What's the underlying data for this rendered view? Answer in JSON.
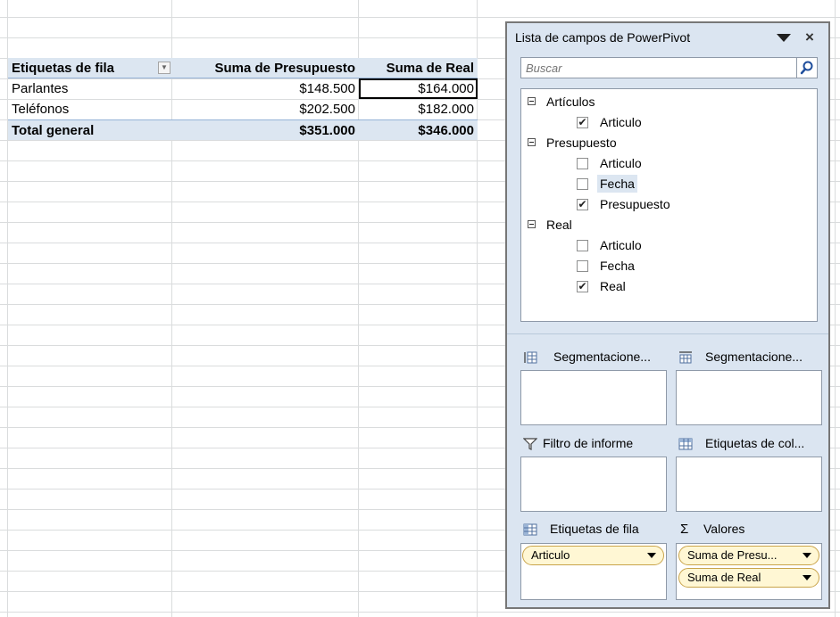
{
  "pivot": {
    "header": {
      "row_labels": "Etiquetas de fila",
      "col_budget": "Suma de Presupuesto",
      "col_actual": "Suma de Real"
    },
    "rows": [
      {
        "label": "Parlantes",
        "budget": "$148.500",
        "actual": "$164.000"
      },
      {
        "label": "Teléfonos",
        "budget": "$202.500",
        "actual": "$182.000"
      }
    ],
    "total": {
      "label": "Total general",
      "budget": "$351.000",
      "actual": "$346.000"
    },
    "dropdown_glyph": "▼"
  },
  "pane": {
    "title": "Lista de campos de PowerPivot",
    "close_glyph": "×",
    "search_placeholder": "Buscar",
    "tables": [
      {
        "name": "Artículos",
        "fields": [
          {
            "name": "Articulo",
            "checked": true
          }
        ]
      },
      {
        "name": "Presupuesto",
        "fields": [
          {
            "name": "Articulo",
            "checked": false
          },
          {
            "name": "Fecha",
            "checked": false
          },
          {
            "name": "Presupuesto",
            "checked": true
          }
        ]
      },
      {
        "name": "Real",
        "fields": [
          {
            "name": "Articulo",
            "checked": false
          },
          {
            "name": "Fecha",
            "checked": false
          },
          {
            "name": "Real",
            "checked": true
          }
        ]
      }
    ],
    "check_glyph": "✔",
    "sections": {
      "slicers_vertical": "Segmentacione...",
      "slicers_horizontal": "Segmentacione...",
      "report_filter": "Filtro de informe",
      "column_labels": "Etiquetas de col...",
      "row_labels": "Etiquetas de fila",
      "values": "Valores",
      "values_glyph": "Σ"
    },
    "row_fields": [
      "Articulo"
    ],
    "value_fields": [
      "Suma de Presu...",
      "Suma de Real"
    ]
  }
}
